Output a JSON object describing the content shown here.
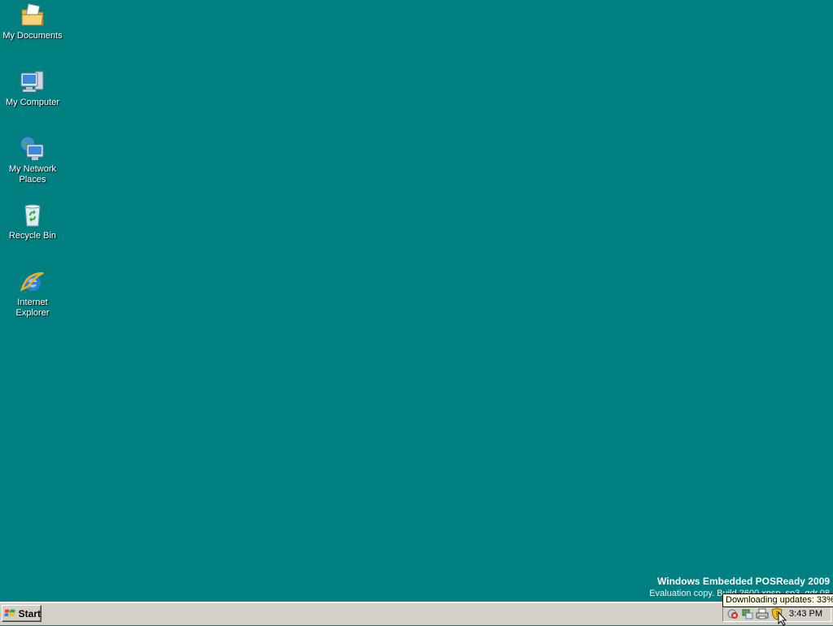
{
  "desktop": {
    "icons": [
      {
        "label": "My Documents",
        "icon": "my-documents-icon"
      },
      {
        "label": "My Computer",
        "icon": "my-computer-icon"
      },
      {
        "label": "My Network Places",
        "icon": "network-places-icon"
      },
      {
        "label": "Recycle Bin",
        "icon": "recycle-bin-icon"
      },
      {
        "label": "Internet Explorer",
        "icon": "internet-explorer-icon"
      }
    ],
    "background_color": "#008080"
  },
  "watermark": {
    "title": "Windows Embedded POSReady 2009",
    "build": "Evaluation copy. Build 2600.xpsp_sp3_gdr.08"
  },
  "taskbar": {
    "start_label": "Start",
    "clock": "3:43 PM",
    "tray_icons": [
      "network-warning-icon",
      "connection-icon",
      "printer-icon",
      "security-shield-icon"
    ]
  },
  "tooltip": {
    "text": "Downloading updates: 33%"
  }
}
